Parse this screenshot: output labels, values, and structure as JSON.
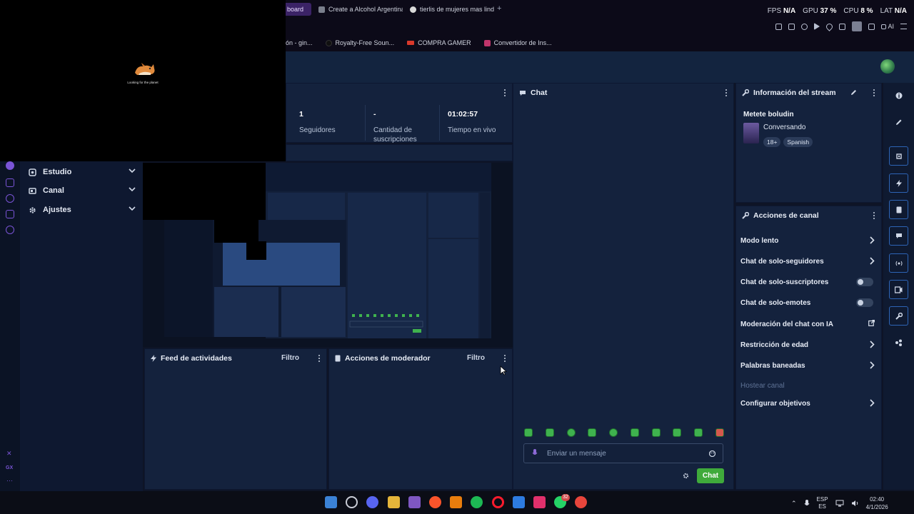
{
  "browser": {
    "tabs": [
      {
        "label": "board",
        "active": true,
        "color": "#6b4ad6"
      },
      {
        "label": "Create a Alcohol Argentina",
        "active": false,
        "color": "#7a7f8c"
      },
      {
        "label": "tierlis de mujeres mas lindas",
        "active": false,
        "color": "#d9d9d9"
      }
    ],
    "new_tab": "+",
    "stats": [
      {
        "label": "FPS",
        "value": "N/A"
      },
      {
        "label": "GPU",
        "value": "37 %"
      },
      {
        "label": "CPU",
        "value": "8 %"
      },
      {
        "label": "LAT",
        "value": "N/A"
      }
    ],
    "ai_label": "AI",
    "bookmarks": [
      {
        "label": "ón - gin...",
        "color": "#3a3f4d"
      },
      {
        "label": "Royalty-Free Soun...",
        "color": "#101010"
      },
      {
        "label": "COMPRA GAMER",
        "color": "#d9392b"
      },
      {
        "label": "Convertidor de Ins...",
        "color": "#c0356b"
      }
    ]
  },
  "overlay": {
    "caption": "Looking for the planet"
  },
  "stats_panel": {
    "items": [
      {
        "value": "1",
        "label": "Seguidores"
      },
      {
        "value": "-",
        "label": "Cantidad de suscripciones"
      },
      {
        "value": "01:02:57",
        "label": "Tiempo en vivo"
      }
    ]
  },
  "nav": {
    "items": [
      {
        "label": "Estudio",
        "icon": "studio-icon"
      },
      {
        "label": "Canal",
        "icon": "channel-icon"
      },
      {
        "label": "Ajustes",
        "icon": "gear-icon"
      }
    ],
    "bottom": [
      "GX"
    ]
  },
  "feed": {
    "title": "Feed de actividades",
    "filter": "Filtro"
  },
  "mod": {
    "title": "Acciones de moderador",
    "filter": "Filtro"
  },
  "chat": {
    "title": "Chat",
    "placeholder": "Enviar un mensaje",
    "send_label": "Chat",
    "emote_count": 10
  },
  "info": {
    "title": "Información del stream",
    "stream_title": "Metete boludin",
    "category": "Conversando",
    "tags": [
      "18+",
      "Spanish"
    ]
  },
  "acciones": {
    "title": "Acciones de canal",
    "items": [
      {
        "label": "Modo lento",
        "control": "arrow"
      },
      {
        "label": "Chat de solo-seguidores",
        "control": "arrow"
      },
      {
        "label": "Chat de solo-suscriptores",
        "control": "toggle",
        "on": false
      },
      {
        "label": "Chat de solo-emotes",
        "control": "toggle",
        "on": false
      },
      {
        "label": "Moderación del chat con IA",
        "control": "external"
      },
      {
        "label": "Restricción de edad",
        "control": "arrow"
      },
      {
        "label": "Palabras baneadas",
        "control": "arrow"
      },
      {
        "label": "Hostear canal",
        "control": "none",
        "disabled": true
      },
      {
        "label": "Configurar objetivos",
        "control": "arrow"
      }
    ]
  },
  "taskbar": {
    "apps": [
      "windows-icon",
      "search-icon",
      "discord-icon",
      "folder-icon",
      "visual-studio-icon",
      "brave-icon",
      "blender-icon",
      "spotify-icon",
      "opera-icon",
      "notepad-icon",
      "instagram-icon",
      "whatsapp-icon",
      "chrome-icon"
    ],
    "whatsapp_badge": "32",
    "lang_top": "ESP",
    "lang_bottom": "ES",
    "time": "02:40",
    "date": "4/1/2026"
  }
}
